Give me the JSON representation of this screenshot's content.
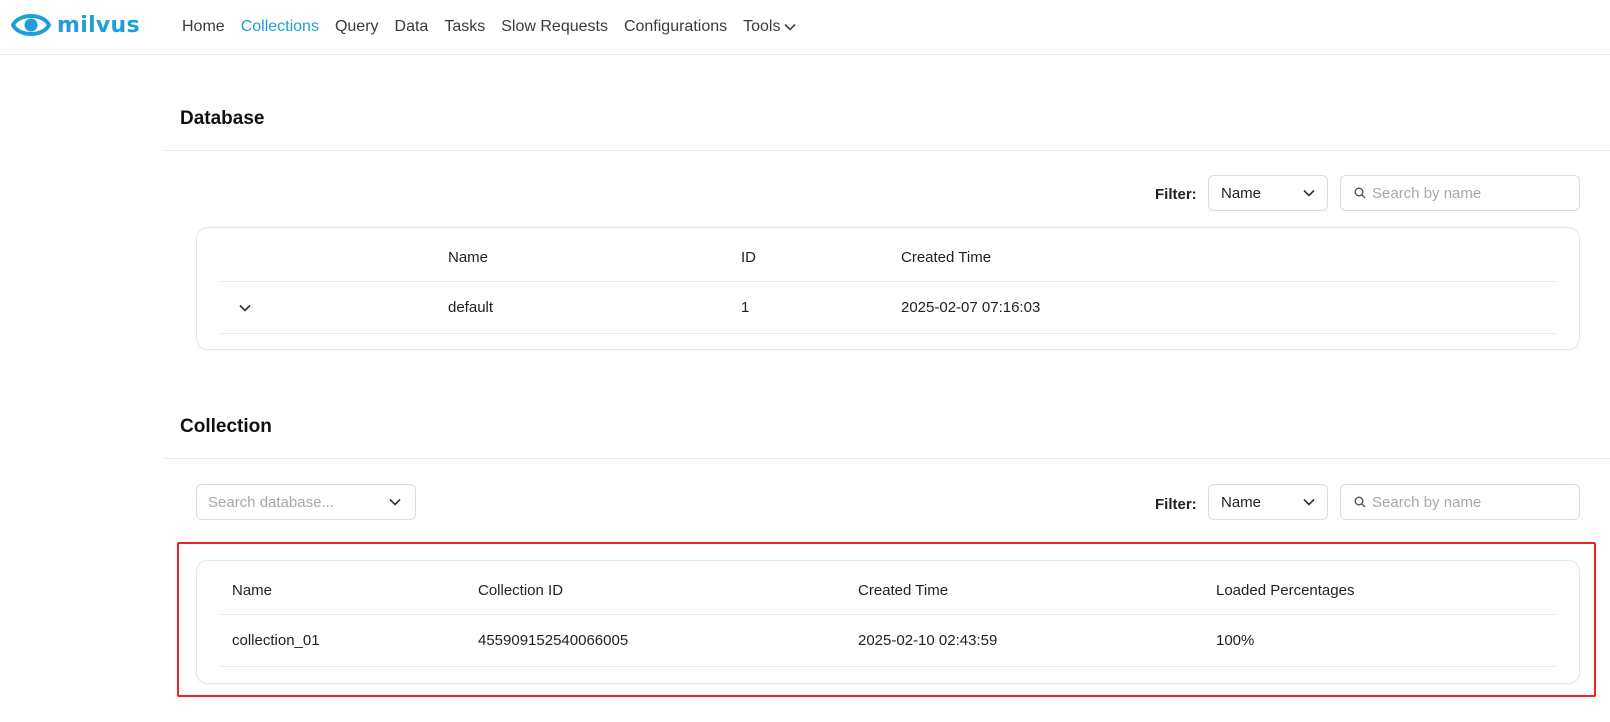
{
  "app": {
    "logo_text": "milvus",
    "accent_color": "#1e9fd8"
  },
  "nav": {
    "items": [
      {
        "label": "Home",
        "active": false
      },
      {
        "label": "Collections",
        "active": true
      },
      {
        "label": "Query",
        "active": false
      },
      {
        "label": "Data",
        "active": false
      },
      {
        "label": "Tasks",
        "active": false
      },
      {
        "label": "Slow Requests",
        "active": false
      },
      {
        "label": "Configurations",
        "active": false
      }
    ],
    "tools_label": "Tools",
    "tools_icon": "chevron-down-icon"
  },
  "database": {
    "title": "Database",
    "filter_label": "Filter:",
    "filter_value": "Name",
    "search_placeholder": "Search by name",
    "columns": [
      "Name",
      "ID",
      "Created Time"
    ],
    "rows": [
      {
        "expand_icon": "chevron-down-icon",
        "name": "default",
        "id": "1",
        "created": "2025-02-07 07:16:03"
      }
    ]
  },
  "collection": {
    "title": "Collection",
    "db_search_placeholder": "Search database...",
    "filter_label": "Filter:",
    "filter_value": "Name",
    "search_placeholder": "Search by name",
    "columns": [
      "Name",
      "Collection ID",
      "Created Time",
      "Loaded Percentages"
    ],
    "rows": [
      {
        "name": "collection_01",
        "collection_id": "455909152540066005",
        "created": "2025-02-10 02:43:59",
        "loaded": "100%"
      }
    ]
  },
  "highlight_color": "#ee2222"
}
